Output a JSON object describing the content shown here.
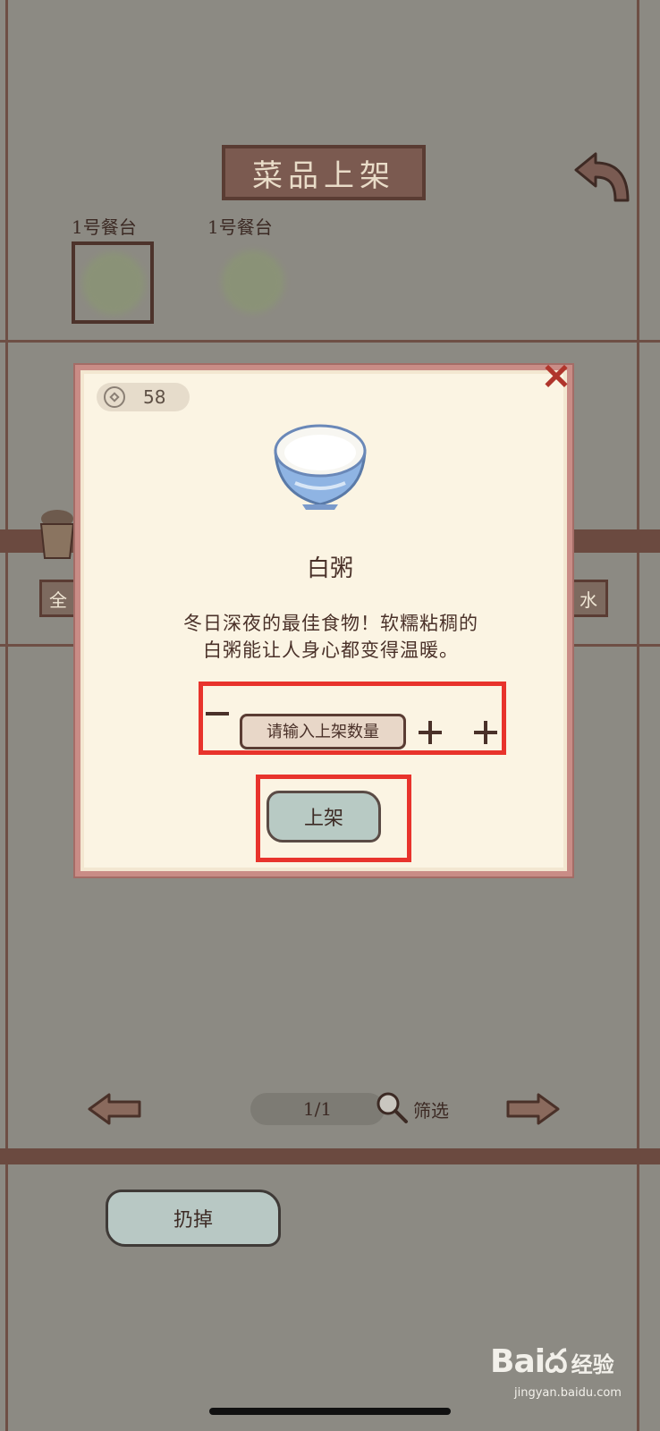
{
  "header": {
    "title": "菜品上架"
  },
  "tables": [
    {
      "label": "1号餐台"
    },
    {
      "label": "1号餐台"
    }
  ],
  "category_tabs": {
    "left_partial": "全",
    "right_partial": "水"
  },
  "modal": {
    "coins": "58",
    "dish_name": "白粥",
    "description_line1": "冬日深夜的最佳食物！软糯粘稠的",
    "description_line2": "白粥能让人身心都变得温暖。",
    "quantity_placeholder": "请输入上架数量",
    "shelve_button": "上架"
  },
  "pagination": {
    "page": "1/1",
    "filter_label": "筛选"
  },
  "discard_button": "扔掉",
  "watermark": {
    "logo": "Baiద",
    "sub": "经验",
    "url": "jingyan.baidu.com"
  },
  "colors": {
    "highlight": "#e8332c",
    "modal_border": "#c98c86",
    "background": "#8c8a83"
  }
}
